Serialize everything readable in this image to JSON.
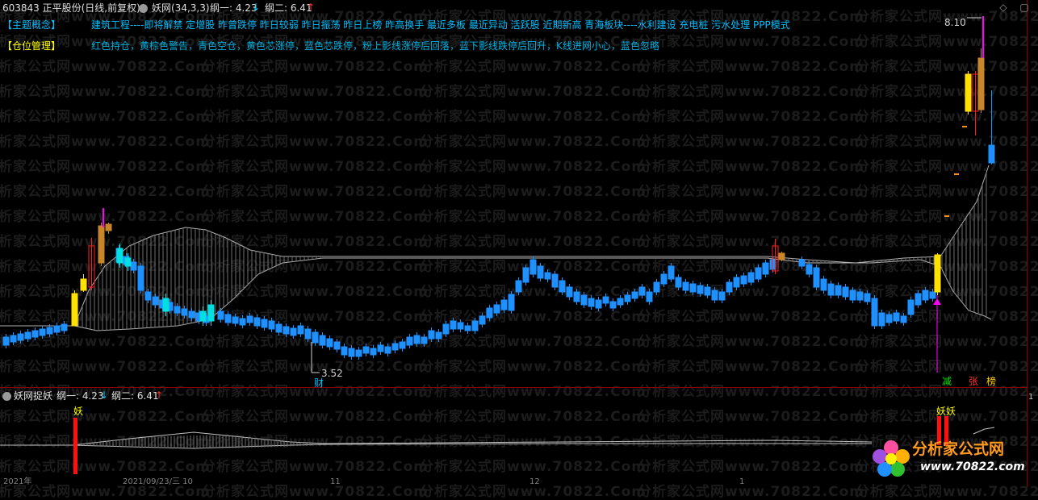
{
  "header": {
    "stock_title": "603843 正平股份(日线,前复权)",
    "indicator_name": "妖网(34,3,3)",
    "gang1_label": "纲一: 4.23",
    "gang1_arrow": "↓",
    "gang2_label": "纲二: 6.41",
    "gang2_arrow": "↑"
  },
  "info": {
    "theme_label": "【主题概念】",
    "theme_text": "建筑工程----即将解禁 定增股 昨曾跌停 昨日较弱 昨日振荡 昨日上榜 昨高换手 最近多板 最近异动 活跃股 近期新高 青海板块----水利建设 充电桩 污水处理 PPP模式",
    "position_label": "【仓位管理】",
    "position_text": "红色持仓，黄棕色警告，青色空仓，黄色芯涨停，蓝色芯跌停，粉上影线涨停后回落，蓝下影线跌停后回升，K线进网小心，蓝色忽略"
  },
  "chart_labels": {
    "high": "8.10",
    "low": "3.52",
    "cai": "财",
    "jian": "减",
    "zhang": "张",
    "bang": "榜"
  },
  "sub": {
    "title": "妖网捉妖",
    "gang1_label": "纲一: 4.23",
    "gang1_arrow": "↓",
    "gang2_label": "纲二: 6.41",
    "gang2_arrow": "↑",
    "yao1": "妖",
    "yao2": "妖妖",
    "right_scale": "1"
  },
  "axis": {
    "d1": "2021年",
    "d2": "2021/09/23/三 10",
    "d3": "11",
    "d4": "12",
    "d5": "1"
  },
  "watermark": {
    "line": "分析家公式网www.70822.Com"
  },
  "logo": {
    "name": "分析家公式网",
    "url": "www.70822.com"
  },
  "colors": {
    "up_red": "#ff2020",
    "down_blue": "#1e90ff",
    "cyan": "#00e0e0",
    "yellow": "#ffe000",
    "brown": "#c8862a",
    "magenta": "#ff00ff",
    "text_cyan": "#00c0ff",
    "label_yellow": "#ffff00"
  },
  "chart_data": {
    "type": "candlestick",
    "title": "603843 正平股份(日线,前复权)",
    "price_high": 8.1,
    "price_low": 3.52,
    "gang1": 4.23,
    "gang2": 6.41,
    "ylim": [
      3.3,
      8.3
    ]
  }
}
